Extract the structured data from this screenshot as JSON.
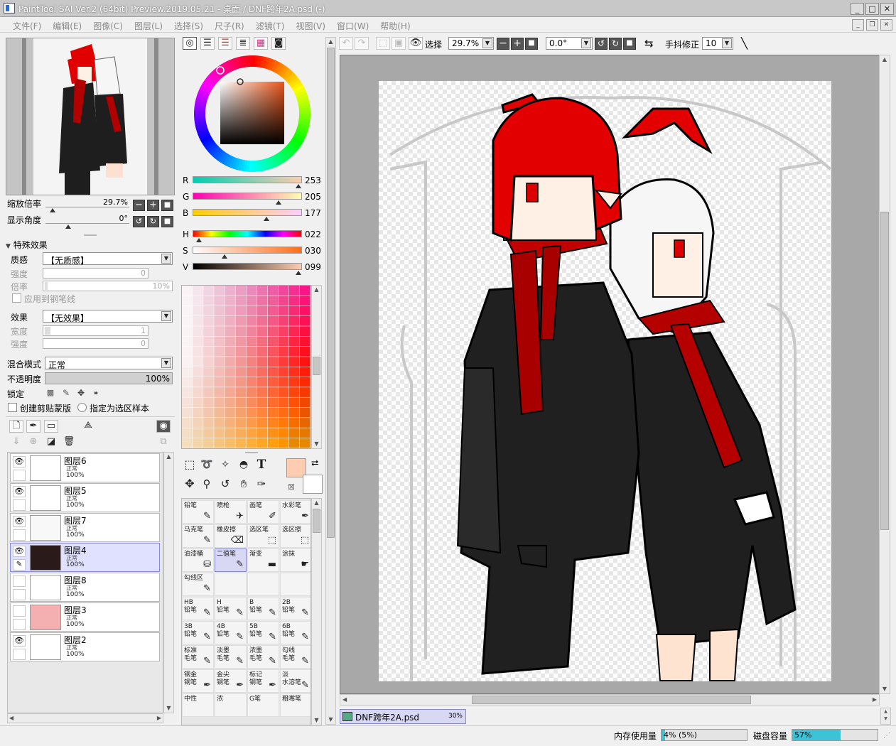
{
  "window": {
    "title": "PaintTool SAI Ver.2 (64bit) Preview.2019.05.21 - 桌面 / DNF跨年2A.psd (-)",
    "min": "_",
    "max": "□",
    "close": "✕"
  },
  "menu": [
    "文件(F)",
    "编辑(E)",
    "图像(C)",
    "图层(L)",
    "选择(S)",
    "尺子(R)",
    "滤镜(T)",
    "视图(V)",
    "窗口(W)",
    "帮助(H)"
  ],
  "navigator": {
    "zoom_label": "缩放倍率",
    "zoom_value": "29.7%",
    "angle_label": "显示角度",
    "angle_value": "0°"
  },
  "effects": {
    "header": "特殊效果",
    "texture_label": "质感",
    "texture_value": "【无质感】",
    "strength_label": "强度",
    "strength_value": "0",
    "scale_label": "倍率",
    "scale_value": "10%",
    "apply_pen": "应用到钢笔线",
    "effect_label": "效果",
    "effect_value": "【无效果】",
    "width_label": "宽度",
    "width_value": "1",
    "effect_strength_label": "强度",
    "effect_strength_value": "0"
  },
  "blend": {
    "mode_label": "混合模式",
    "mode_value": "正常",
    "opacity_label": "不透明度",
    "opacity_value": "100%",
    "lock_label": "锁定",
    "clip_label": "创建剪贴蒙版",
    "sample_label": "指定为选区样本"
  },
  "layers": [
    {
      "name": "图层6",
      "mode": "正常",
      "opacity": "100%",
      "visible": true,
      "selected": false
    },
    {
      "name": "图层5",
      "mode": "正常",
      "opacity": "100%",
      "visible": true,
      "selected": false
    },
    {
      "name": "图层7",
      "mode": "正常",
      "opacity": "100%",
      "visible": true,
      "selected": false
    },
    {
      "name": "图层4",
      "mode": "正常",
      "opacity": "100%",
      "visible": true,
      "selected": true
    },
    {
      "name": "图层8",
      "mode": "正常",
      "opacity": "100%",
      "visible": false,
      "selected": false
    },
    {
      "name": "图层3",
      "mode": "正常",
      "opacity": "100%",
      "visible": false,
      "selected": false
    },
    {
      "name": "图层2",
      "mode": "正常",
      "opacity": "100%",
      "visible": true,
      "selected": false
    }
  ],
  "color": {
    "r_label": "R",
    "r_value": "253",
    "r_fraction": 0.992,
    "g_label": "G",
    "g_value": "205",
    "g_fraction": 0.804,
    "b_label": "B",
    "b_value": "177",
    "b_fraction": 0.694,
    "h_label": "H",
    "h_value": "022",
    "h_fraction": 0.061,
    "s_label": "S",
    "s_value": "030",
    "s_fraction": 0.3,
    "v_label": "V",
    "v_value": "099",
    "v_fraction": 0.99,
    "foreground": "#fdcdb1",
    "background": "#ffffff"
  },
  "tools": [
    {
      "label": "铅笔",
      "selected": false
    },
    {
      "label": "喷枪",
      "selected": false
    },
    {
      "label": "画笔",
      "selected": false
    },
    {
      "label": "水彩笔",
      "selected": false
    },
    {
      "label": "马克笔",
      "selected": false
    },
    {
      "label": "橡皮擦",
      "selected": false
    },
    {
      "label": "选区笔",
      "selected": false
    },
    {
      "label": "选区擦",
      "selected": false
    },
    {
      "label": "油漆桶",
      "selected": false
    },
    {
      "label": "二值笔",
      "selected": true
    },
    {
      "label": "渐变",
      "selected": false
    },
    {
      "label": "涂抹",
      "selected": false
    },
    {
      "label": "勾线区",
      "selected": false
    },
    {
      "label": "",
      "selected": false
    },
    {
      "label": "",
      "selected": false
    },
    {
      "label": "",
      "selected": false
    },
    {
      "label": "HB\n铅笔",
      "selected": false
    },
    {
      "label": "H\n铅笔",
      "selected": false
    },
    {
      "label": "B\n铅笔",
      "selected": false
    },
    {
      "label": "2B\n铅笔",
      "selected": false
    },
    {
      "label": "3B\n铅笔",
      "selected": false
    },
    {
      "label": "4B\n铅笔",
      "selected": false
    },
    {
      "label": "5B\n铅笔",
      "selected": false
    },
    {
      "label": "6B\n铅笔",
      "selected": false
    },
    {
      "label": "标准\n毛笔",
      "selected": false
    },
    {
      "label": "淡墨\n毛笔",
      "selected": false
    },
    {
      "label": "浓墨\n毛笔",
      "selected": false
    },
    {
      "label": "勾线\n毛笔",
      "selected": false
    },
    {
      "label": "钢金\n钢笔",
      "selected": false
    },
    {
      "label": "金尖\n钢笔",
      "selected": false
    },
    {
      "label": "标记\n钢笔",
      "selected": false
    },
    {
      "label": "淡\n水溶笔",
      "selected": false
    },
    {
      "label": "中性",
      "selected": false
    },
    {
      "label": "浓",
      "selected": false
    },
    {
      "label": "G笔",
      "selected": false
    },
    {
      "label": "粗嘴笔",
      "selected": false
    }
  ],
  "canvas_toolbar": {
    "select_label": "选择",
    "zoom": "29.7%",
    "angle": "0.0°",
    "stabilizer_label": "手抖修正",
    "stabilizer_value": "10"
  },
  "document_tab": {
    "name": "DNF跨年2A.psd",
    "zoom": "30%"
  },
  "status": {
    "memory_label": "内存使用量",
    "memory_value": "4% (5%)",
    "memory_fraction": 0.04,
    "disk_label": "磁盘容量",
    "disk_value": "57%",
    "disk_fraction": 0.57
  }
}
